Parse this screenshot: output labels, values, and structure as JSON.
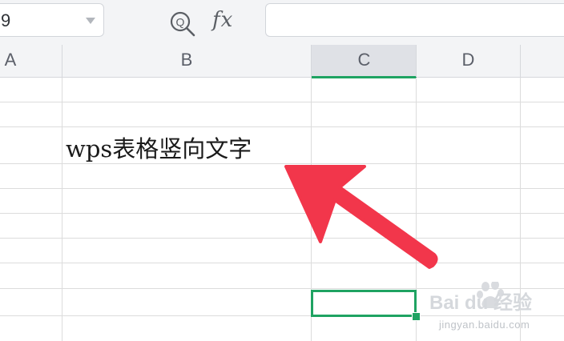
{
  "toolbar": {
    "name_box_value": "9",
    "zoom_icon": "zoom-magnifier-icon",
    "fx_label": "fx",
    "formula_value": ""
  },
  "columns": [
    "A",
    "B",
    "C",
    "D"
  ],
  "selected_column": "C",
  "cells": {
    "b3": "wps表格竖向文字"
  },
  "colors": {
    "accent": "#1fa362",
    "arrow": "#f2364b",
    "toolbar_bg": "#f3f4f6"
  },
  "watermark": {
    "logo_text": "Bai du 经验",
    "url": "jingyan.baidu.com"
  }
}
